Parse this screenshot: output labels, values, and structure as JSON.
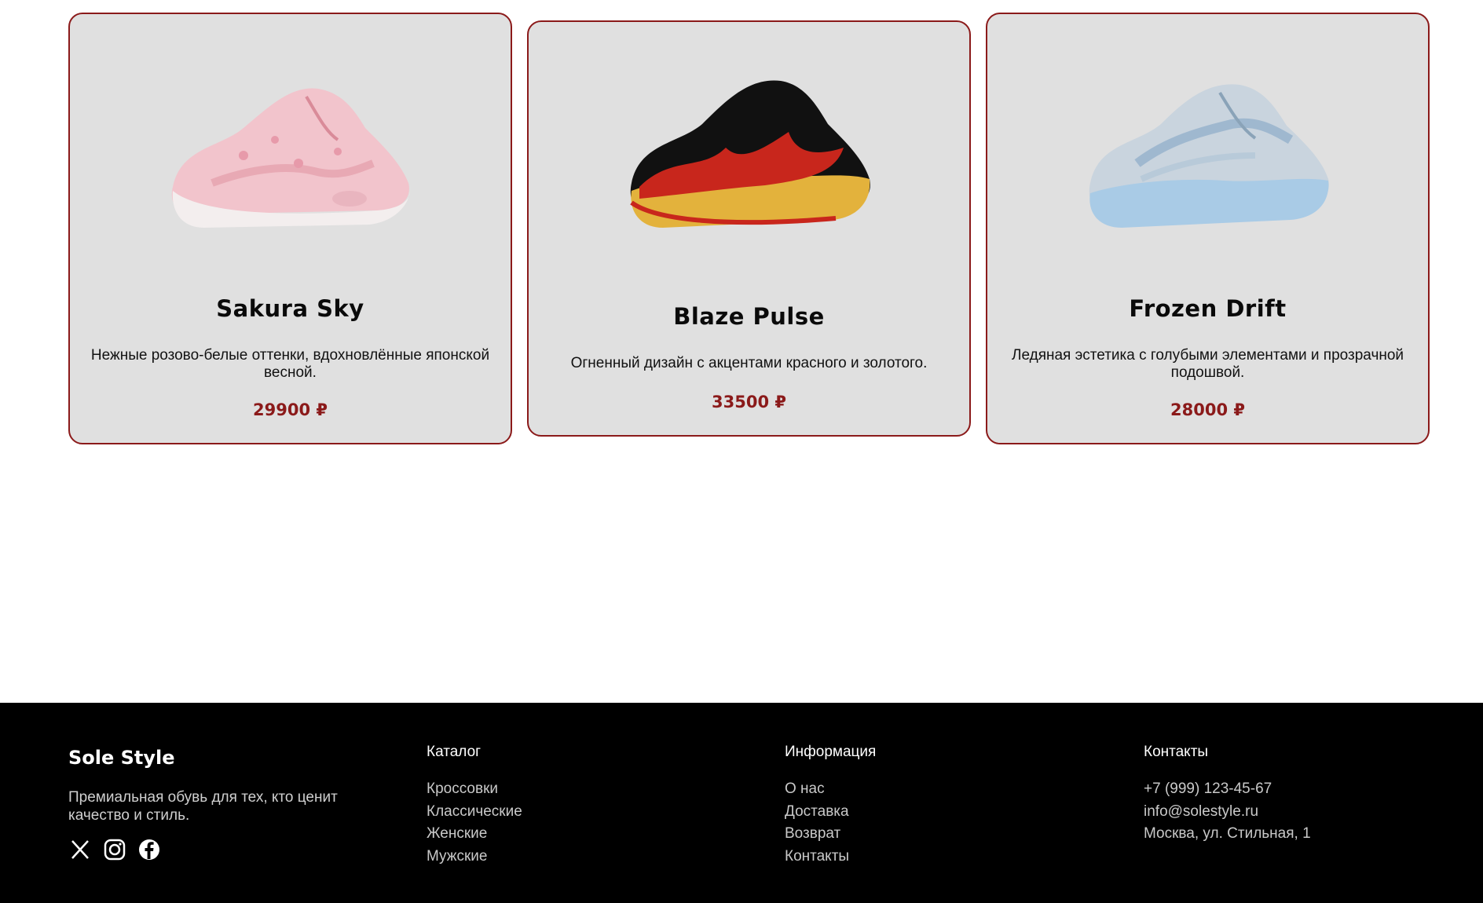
{
  "products": [
    {
      "name": "Sakura Sky",
      "description": "Нежные розово-белые оттенки, вдохновлённые японской весной.",
      "price": "29900 ₽",
      "image_icon": "pink-sneaker-image"
    },
    {
      "name": "Blaze Pulse",
      "description": "Огненный дизайн с акцентами красного и золотого.",
      "price": "33500 ₽",
      "image_icon": "red-gold-sneaker-image"
    },
    {
      "name": "Frozen Drift",
      "description": "Ледяная эстетика с голубыми элементами и прозрачной подошвой.",
      "price": "28000 ₽",
      "image_icon": "blue-sneaker-image"
    }
  ],
  "footer": {
    "brand": "Sole Style",
    "tagline": "Премиальная обувь для тех, кто ценит качество и стиль.",
    "socials": [
      "x-icon",
      "instagram-icon",
      "facebook-icon"
    ],
    "catalog": {
      "heading": "Каталог",
      "items": [
        "Кроссовки",
        "Классические",
        "Женские",
        "Мужские"
      ]
    },
    "info": {
      "heading": "Информация",
      "items": [
        "О нас",
        "Доставка",
        "Возврат",
        "Контакты"
      ]
    },
    "contacts": {
      "heading": "Контакты",
      "items": [
        "+7 (999) 123-45-67",
        "info@solestyle.ru",
        "Москва, ул. Стильная, 1"
      ]
    }
  },
  "colors": {
    "accent": "#8b1a1a",
    "card_bg": "#e0e0e0",
    "footer_bg": "#000000"
  }
}
